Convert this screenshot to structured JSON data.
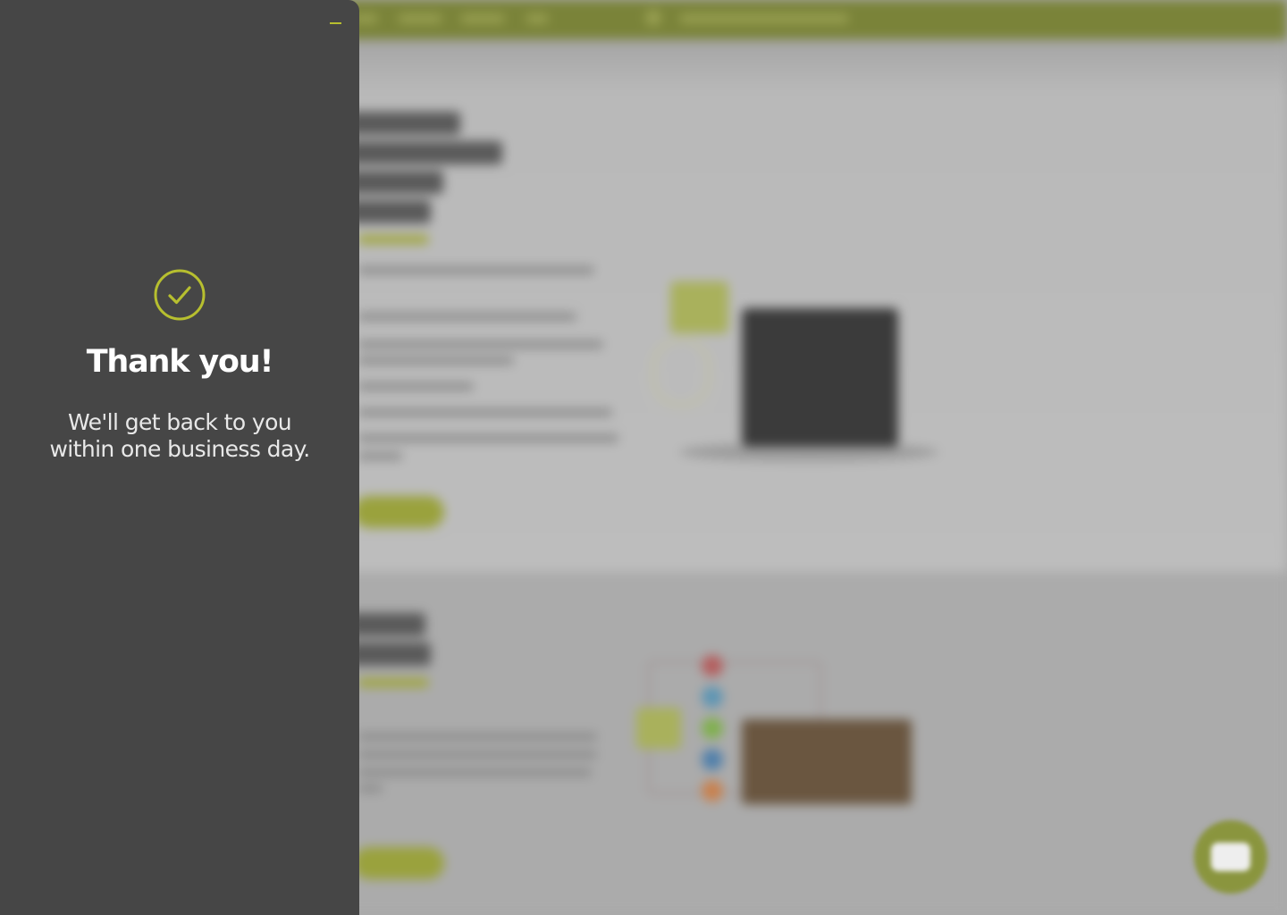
{
  "colors": {
    "accent": "#b7bf2f",
    "panel_background": "#464646",
    "topbar_background": "#7a8339"
  },
  "confirmation_panel": {
    "icon": "check-circle-icon",
    "title": "Thank you!",
    "message_line_1": "We'll get back to you",
    "message_line_2": "within one business day.",
    "minimize_icon": "minimize-icon"
  },
  "chat_launcher": {
    "icon": "chat-bubble-icon"
  }
}
